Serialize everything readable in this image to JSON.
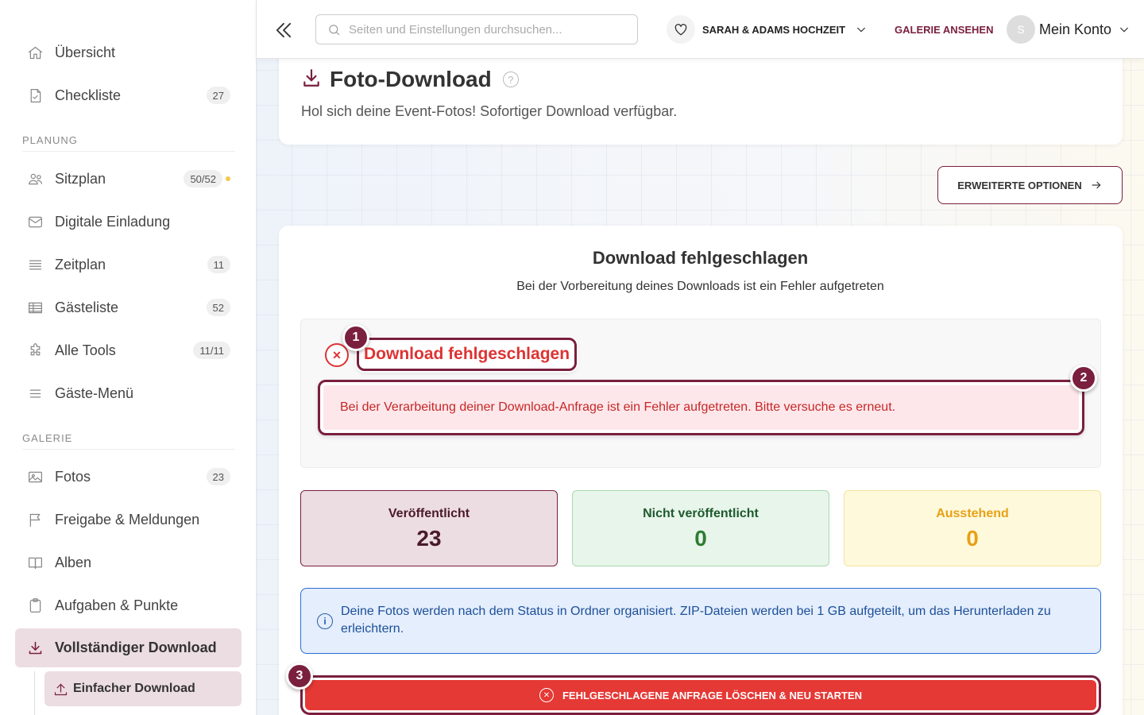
{
  "sidebar": {
    "items_top": [
      {
        "label": "Übersicht",
        "icon": "home-icon"
      },
      {
        "label": "Checkliste",
        "icon": "checklist-icon",
        "badge": "27"
      }
    ],
    "section_planung": "PLANUNG",
    "items_planung": [
      {
        "label": "Sitzplan",
        "icon": "users-icon",
        "badge": "50/52"
      },
      {
        "label": "Digitale Einladung",
        "icon": "mail-icon"
      },
      {
        "label": "Zeitplan",
        "icon": "list-icon",
        "badge": "11"
      },
      {
        "label": "Gästeliste",
        "icon": "table-icon",
        "badge": "52"
      },
      {
        "label": "Alle Tools",
        "icon": "puzzle-icon",
        "badge": "11/11"
      },
      {
        "label": "Gäste-Menü",
        "icon": "menu-icon"
      }
    ],
    "section_galerie": "GALERIE",
    "items_galerie": [
      {
        "label": "Fotos",
        "icon": "image-icon",
        "badge": "23"
      },
      {
        "label": "Freigabe & Meldungen",
        "icon": "flag-icon"
      },
      {
        "label": "Alben",
        "icon": "book-icon"
      },
      {
        "label": "Aufgaben & Punkte",
        "icon": "clipboard-icon"
      },
      {
        "label": "Vollständiger Download",
        "icon": "download-icon"
      }
    ],
    "sub_item": {
      "label": "Einfacher Download",
      "icon": "upload-icon"
    }
  },
  "topbar": {
    "search_placeholder": "Seiten und Einstellungen durchsuchen...",
    "event_name": "SARAH & ADAMS HOCHZEIT",
    "gallery_link": "GALERIE ANSEHEN",
    "avatar_initial": "S",
    "account_label": "Mein Konto"
  },
  "header": {
    "title": "Foto-Download",
    "help_icon": "?",
    "subtitle": "Hol sich deine Event-Fotos! Sofortiger Download verfügbar."
  },
  "advanced_button": "ERWEITERTE OPTIONEN",
  "card": {
    "title": "Download fehlgeschlagen",
    "subtitle": "Bei der Vorbereitung deines Downloads ist ein Fehler aufgetreten",
    "error_title": "Download fehlgeschlagen",
    "error_message": "Bei der Verarbeitung deiner Download-Anfrage ist ein Fehler aufgetreten. Bitte versuche es erneut.",
    "markers": [
      "1",
      "2",
      "3"
    ]
  },
  "stats": {
    "published": {
      "label": "Veröffentlicht",
      "value": "23"
    },
    "unpublished": {
      "label": "Nicht veröffentlicht",
      "value": "0"
    },
    "pending": {
      "label": "Ausstehend",
      "value": "0"
    }
  },
  "info": {
    "icon": "i",
    "text": "Deine Fotos werden nach dem Status in Ordner organisiert. ZIP-Dateien werden bei 1 GB aufgeteilt, um das Herunterladen zu erleichtern."
  },
  "reset_button": "FEHLGESCHLAGENE ANFRAGE LÖSCHEN & NEU STARTEN",
  "colors": {
    "brand": "#7a1f3d",
    "error": "#d33",
    "info": "#2b6cd4",
    "danger_button": "#e53935"
  }
}
